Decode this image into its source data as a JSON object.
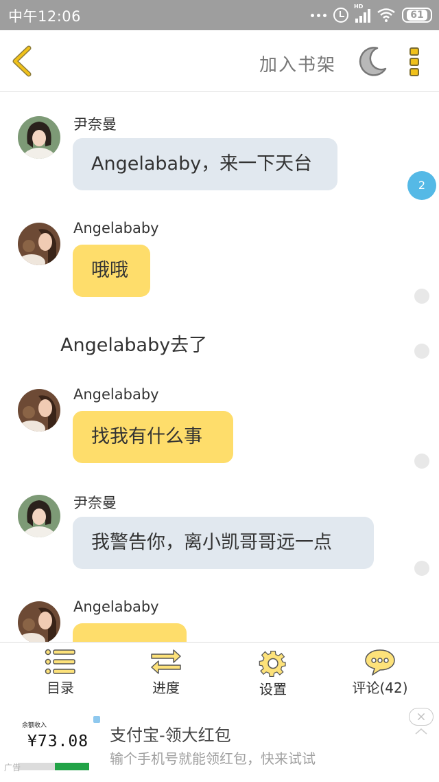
{
  "status_bar": {
    "time": "中午12:06",
    "battery": "61",
    "signal_badge": "HD"
  },
  "header": {
    "back_icon": "chevron-left-icon",
    "add_to_shelf": "加入书架",
    "night_mode_icon": "moon-icon",
    "more_icon": "vertical-dots-icon",
    "accent_color": "#f0c11a"
  },
  "chat": {
    "messages": [
      {
        "type": "message",
        "sender": "尹奈曼",
        "text": "Angelababy，来一下天台",
        "bubble_color": "#e1e8ef",
        "comment_count": "2"
      },
      {
        "type": "message",
        "sender": "Angelababy",
        "text": "哦哦",
        "bubble_color": "#fedd6b"
      },
      {
        "type": "narration",
        "text": "Angelababy去了"
      },
      {
        "type": "message",
        "sender": "Angelababy",
        "text": "找我有什么事",
        "bubble_color": "#fedd6b"
      },
      {
        "type": "message",
        "sender": "尹奈曼",
        "text": "我警告你，离小凯哥哥远一点",
        "bubble_color": "#e1e8ef"
      },
      {
        "type": "message",
        "sender": "Angelababy",
        "text": "",
        "bubble_color": "#fedd6b"
      }
    ]
  },
  "toolbar": {
    "items": [
      {
        "label": "目录",
        "icon": "list-icon"
      },
      {
        "label": "进度",
        "icon": "swap-arrows-icon"
      },
      {
        "label": "设置",
        "icon": "gear-icon"
      },
      {
        "label": "评论(42)",
        "icon": "comment-bubble-icon"
      }
    ]
  },
  "ad": {
    "thumb_caption": "余额收入",
    "thumb_amount": "¥73.08",
    "title": "支付宝-领大红包",
    "description": "输个手机号就能领红包，快来试试",
    "label": "广告"
  }
}
